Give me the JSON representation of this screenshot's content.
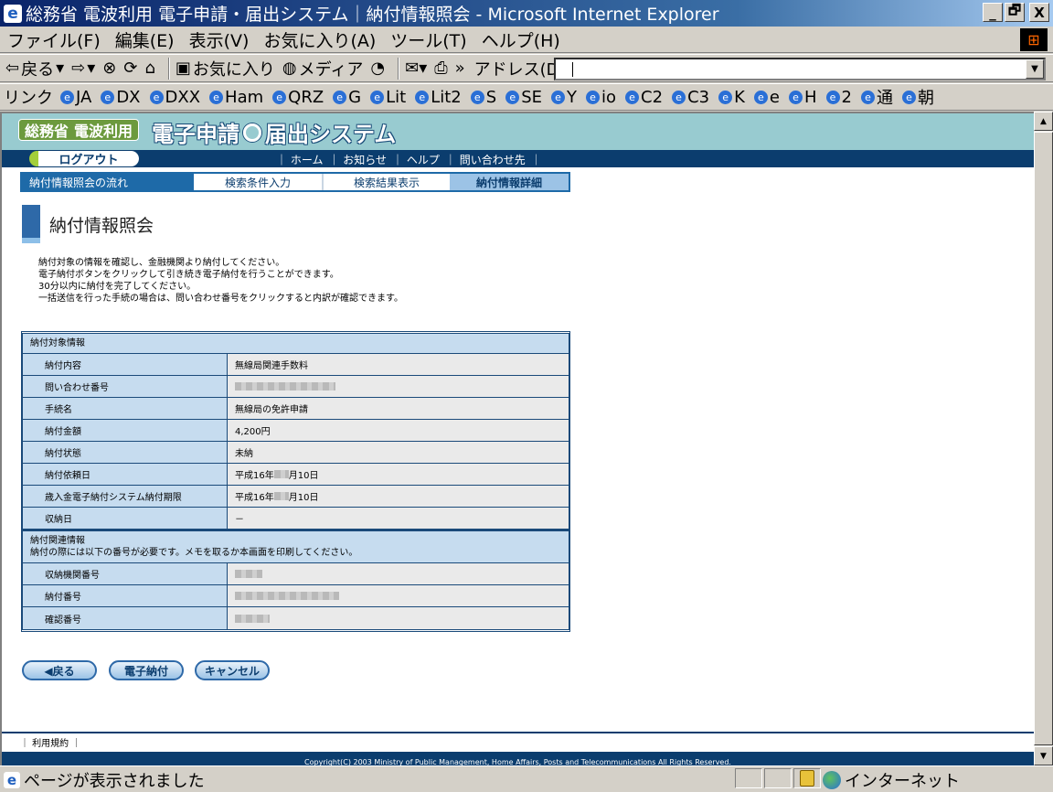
{
  "window": {
    "title": "総務省 電波利用 電子申請・届出システム｜納付情報照会 - Microsoft Internet Explorer",
    "min": "_",
    "max": "🗗",
    "close": "X"
  },
  "menu": [
    "ファイル(F)",
    "編集(E)",
    "表示(V)",
    "お気に入り(A)",
    "ツール(T)",
    "ヘルプ(H)"
  ],
  "toolbar": {
    "back": "戻る",
    "favorites": "お気に入り",
    "media": "メディア",
    "address_label": "アドレス(D)",
    "address_value": ""
  },
  "links": {
    "label": "リンク",
    "items": [
      "JA",
      "DX",
      "DXX",
      "Ham",
      "QRZ",
      "G",
      "Lit",
      "Lit2",
      "S",
      "SE",
      "Y",
      "io",
      "C2",
      "C3",
      "K",
      "e",
      "H",
      "2",
      "通",
      "朝"
    ]
  },
  "site": {
    "logo_ministry": "総務省",
    "logo_radio": "電波利用",
    "logo_system_left": "電子申請",
    "logo_system_right": "届出システム",
    "logout": "ログアウト",
    "nav": [
      "｜ ホーム",
      "｜ お知らせ",
      "｜ ヘルプ",
      "｜ 問い合わせ先",
      "｜"
    ]
  },
  "steps": {
    "label": "納付情報照会の流れ",
    "items": [
      "検索条件入力",
      "検索結果表示",
      "納付情報詳細"
    ]
  },
  "page": {
    "title": "納付情報照会",
    "intro": [
      "納付対象の情報を確認し、金融機関より納付してください。",
      "電子納付ボタンをクリックして引き続き電子納付を行うことができます。",
      "30分以内に納付を完了してください。",
      "一括送信を行った手続の場合は、問い合わせ番号をクリックすると内訳が確認できます。"
    ]
  },
  "table": {
    "section1": "納付対象情報",
    "rows1": [
      {
        "key": "納付内容",
        "value": "無線局関連手数料"
      },
      {
        "key": "問い合わせ番号",
        "value": ""
      },
      {
        "key": "手続名",
        "value": "無線局の免許申請"
      },
      {
        "key": "納付金額",
        "value": "4,200円"
      },
      {
        "key": "納付状態",
        "value": "未納"
      },
      {
        "key": "納付依頼日",
        "value_a": "平成16年",
        "value_b": "月10日"
      },
      {
        "key": "歳入金電子納付システム納付期限",
        "value_a": "平成16年",
        "value_b": "月10日"
      },
      {
        "key": "収納日",
        "value": "－"
      }
    ],
    "section2_title": "納付関連情報",
    "section2_note": "納付の際には以下の番号が必要です。メモを取るか本画面を印刷してください。",
    "rows2": [
      {
        "key": "収納機関番号"
      },
      {
        "key": "納付番号"
      },
      {
        "key": "確認番号"
      }
    ]
  },
  "buttons": {
    "back": "◀戻る",
    "pay": "電子納付",
    "cancel": "キャンセル"
  },
  "footer": {
    "terms": "｜ 利用規約 ｜",
    "copyright": "Copyright(C) 2003 Ministry of Public Management, Home Affairs, Posts and Telecommunications All Rights Reserved."
  },
  "status": {
    "text": "ページが表示されました",
    "zone": "インターネット"
  }
}
